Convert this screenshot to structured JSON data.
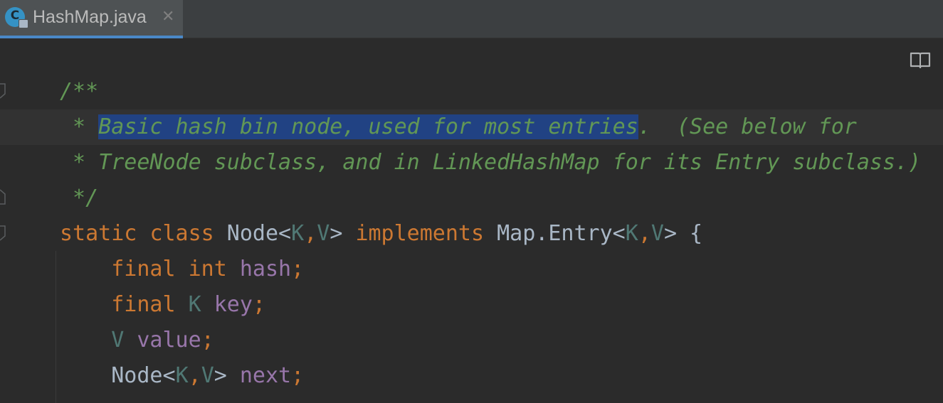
{
  "tab": {
    "title": "HashMap.java",
    "icon_letter": "C",
    "close_glyph": "✕"
  },
  "editor": {
    "reader_mode_icon": "book-icon",
    "lines": [
      [
        "/**"
      ],
      [
        " * ",
        "Basic hash bin node, used for most entries",
        ".  (See below for"
      ],
      [
        " * TreeNode subclass, and in LinkedHashMap for its Entry subclass.)"
      ],
      [
        " */"
      ],
      [
        "static",
        " ",
        "class",
        " Node<",
        "K",
        ",",
        "V",
        "> ",
        "implements",
        " Map.Entry<",
        "K",
        ",",
        "V",
        "> {"
      ],
      [
        "    ",
        "final",
        " ",
        "int",
        " ",
        "hash",
        ";"
      ],
      [
        "    ",
        "final",
        " ",
        "K",
        " ",
        "key",
        ";"
      ],
      [
        "    ",
        "V",
        " ",
        "value",
        ";"
      ],
      [
        "    Node<",
        "K",
        ",",
        "V",
        "> ",
        "next",
        ";"
      ]
    ]
  },
  "colors": {
    "background": "#2b2b2b",
    "comment": "#629755",
    "keyword": "#cc7832",
    "type_param": "#507874",
    "field": "#9876aa",
    "plain": "#a9b7c6",
    "selection": "#214283"
  }
}
